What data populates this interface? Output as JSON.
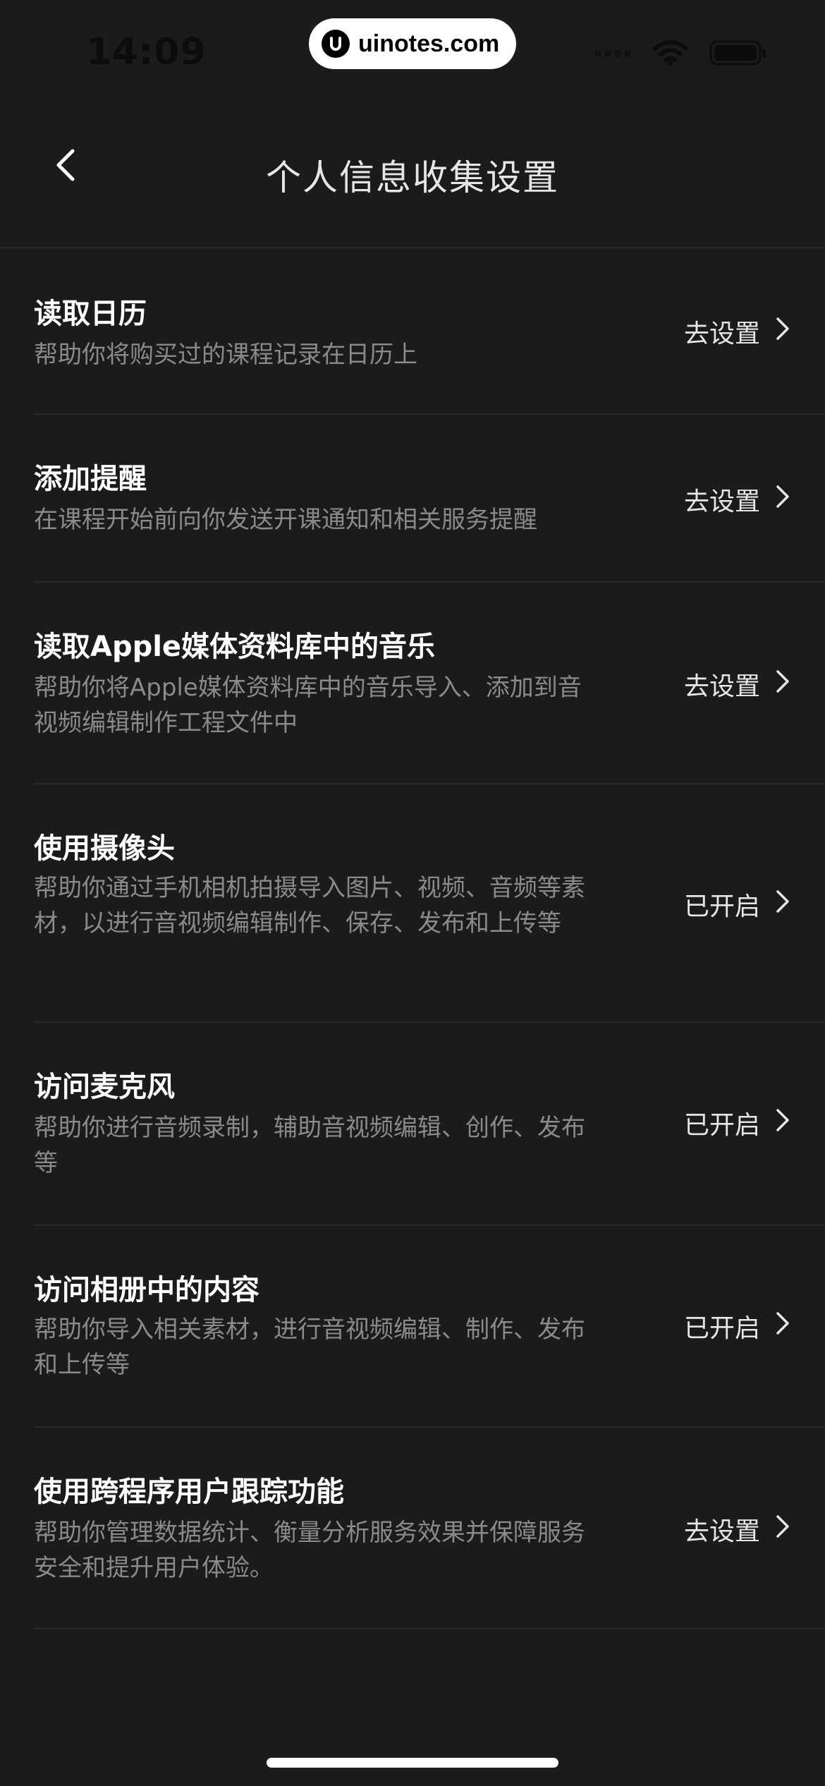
{
  "status_bar": {
    "time": "14:09",
    "watermark": "uinotes.com"
  },
  "header": {
    "title": "个人信息收集设置"
  },
  "settings": [
    {
      "title": "读取日历",
      "desc": "帮助你将购买过的课程记录在日历上",
      "action": "去设置"
    },
    {
      "title": "添加提醒",
      "desc": "在课程开始前向你发送开课通知和相关服务提醒",
      "action": "去设置"
    },
    {
      "title": "读取Apple媒体资料库中的音乐",
      "desc": "帮助你将Apple媒体资料库中的音乐导入、添加到音视频编辑制作工程文件中",
      "action": "去设置"
    },
    {
      "title": "使用摄像头",
      "desc": "帮助你通过手机相机拍摄导入图片、视频、音频等素材，以进行音视频编辑制作、保存、发布和上传等",
      "action": "已开启"
    },
    {
      "title": "访问麦克风",
      "desc": "帮助你进行音频录制，辅助音视频编辑、创作、发布等",
      "action": "已开启"
    },
    {
      "title": "访问相册中的内容",
      "desc": "帮助你导入相关素材，进行音视频编辑、制作、发布和上传等",
      "action": "已开启"
    },
    {
      "title": "使用跨程序用户跟踪功能",
      "desc": "帮助你管理数据统计、衡量分析服务效果并保障服务安全和提升用户体验。",
      "action": "去设置"
    }
  ]
}
